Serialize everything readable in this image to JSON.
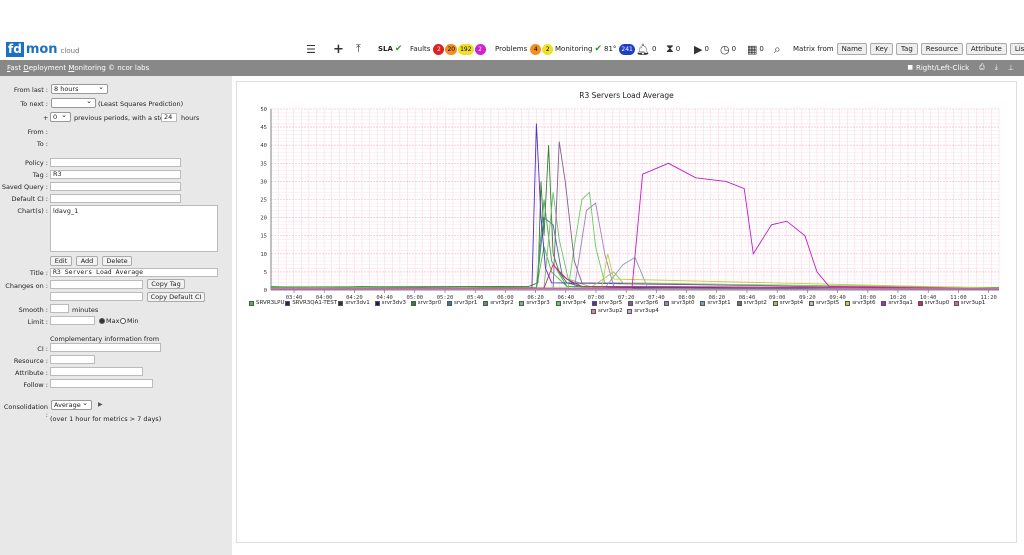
{
  "logo": {
    "fd": "fd",
    "mon": "mon",
    "cloud": "cloud"
  },
  "toolbar": {
    "sla": "SLA",
    "faults_label": "Faults",
    "faults": [
      "2",
      "20",
      "192",
      "2"
    ],
    "problems_label": "Problems",
    "problems": [
      "4",
      "2"
    ],
    "monitoring_label": "Monitoring",
    "monitoring_value": "81°",
    "monitoring_badge": "241",
    "bell_count": "0",
    "hourglass_count": "0",
    "play_count": "0",
    "clock_count": "0",
    "calendar_count": "0",
    "matrix_label": "Matrix from",
    "matrix_buttons": [
      "Name",
      "Key",
      "Tag",
      "Resource",
      "Attribute",
      "List"
    ]
  },
  "subbar": {
    "title_parts": [
      "F",
      "ast ",
      "D",
      "eployment ",
      "M",
      "onitoring © ncor labs"
    ],
    "right_click": "Right/Left-Click"
  },
  "form": {
    "from_last_label": "From last :",
    "from_last_value": "8 hours",
    "to_next_label": "To next :",
    "to_next_value": "",
    "to_next_hint": "(Least Squares Prediction)",
    "plus": "+",
    "periods_value": "0",
    "periods_text": "previous periods, with a step of",
    "step_value": "24",
    "hours": "hours",
    "from_label": "From :",
    "to_label": "To :",
    "policy_label": "Policy :",
    "policy_value": "",
    "tag_label": "Tag :",
    "tag_value": "R3",
    "saved_query_label": "Saved Query :",
    "saved_query_value": "",
    "default_ci_label": "Default CI :",
    "default_ci_value": "",
    "charts_label": "Chart(s) :",
    "charts_value": "ldavg_1",
    "edit": "Edit",
    "add": "Add",
    "delete": "Delete",
    "title_label": "Title :",
    "title_value": "R3 Servers Load Average",
    "changes_on_label": "Changes on :",
    "copy_tag": "Copy Tag",
    "copy_default_ci": "Copy Default CI",
    "smooth_label": "Smooth :",
    "minutes": "minutes",
    "limit_label": "Limit :",
    "max": "Max",
    "min": "Min",
    "complementary": "Complementary information from",
    "ci_label": "CI :",
    "resource_label": "Resource :",
    "attribute_label": "Attribute :",
    "follow_label": "Follow :",
    "consolidation_label": "Consolidation :",
    "consolidation_value": "Average",
    "consolidation_note": "(over 1 hour for metrics > 7 days)"
  },
  "chart_data": {
    "type": "line",
    "title": "R3 Servers Load Average",
    "ylim": [
      0,
      50
    ],
    "yticks": [
      0,
      5,
      10,
      15,
      20,
      25,
      30,
      35,
      40,
      45,
      50
    ],
    "xticks": [
      "03:40",
      "04:00",
      "04:20",
      "04:40",
      "05:00",
      "05:20",
      "05:40",
      "06:00",
      "06:20",
      "06:40",
      "07:00",
      "07:20",
      "07:40",
      "08:00",
      "08:20",
      "08:40",
      "09:00",
      "09:20",
      "09:40",
      "10:00",
      "10:20",
      "10:40",
      "11:00",
      "11:20"
    ],
    "grid": true,
    "legend_position": "bottom",
    "series": [
      {
        "name": "SRVR3LPU",
        "color": "#40c040",
        "points": [
          [
            0,
            1
          ],
          [
            30,
            0.5
          ],
          [
            60,
            1
          ],
          [
            90,
            0.6
          ],
          [
            120,
            0.5
          ],
          [
            150,
            0.8
          ],
          [
            175,
            0.5
          ],
          [
            180,
            12
          ],
          [
            185,
            5
          ],
          [
            195,
            1
          ],
          [
            230,
            0.5
          ],
          [
            260,
            0.8
          ],
          [
            300,
            0.5
          ],
          [
            400,
            0.5
          ],
          [
            480,
            0.7
          ]
        ]
      },
      {
        "name": "SRVR3QA1-TEST",
        "color": "#202080",
        "points": [
          [
            0,
            0.5
          ],
          [
            100,
            0.7
          ],
          [
            180,
            0.4
          ],
          [
            260,
            0.6
          ],
          [
            380,
            0.5
          ],
          [
            480,
            0.5
          ]
        ]
      },
      {
        "name": "srvr3dv1",
        "color": "#303030",
        "points": [
          [
            0,
            0.3
          ],
          [
            200,
            0.4
          ],
          [
            480,
            0.3
          ]
        ]
      },
      {
        "name": "srvr3dv3",
        "color": "#1a1a7a",
        "points": [
          [
            0,
            0.2
          ],
          [
            240,
            0.3
          ],
          [
            480,
            0.2
          ]
        ]
      },
      {
        "name": "srvr3pr0",
        "color": "#308030",
        "points": [
          [
            0,
            0.8
          ],
          [
            170,
            1
          ],
          [
            176,
            2
          ],
          [
            178,
            30
          ],
          [
            180,
            15
          ],
          [
            183,
            40
          ],
          [
            186,
            10
          ],
          [
            190,
            5
          ],
          [
            195,
            2
          ],
          [
            205,
            1
          ],
          [
            230,
            0.8
          ],
          [
            480,
            0.7
          ]
        ]
      },
      {
        "name": "srvr3pr1",
        "color": "#3a7a9a",
        "points": [
          [
            0,
            0.5
          ],
          [
            175,
            0.5
          ],
          [
            180,
            20
          ],
          [
            186,
            18
          ],
          [
            192,
            4
          ],
          [
            202,
            1
          ],
          [
            480,
            0.5
          ]
        ]
      },
      {
        "name": "srvr3pr2",
        "color": "#50a050",
        "points": [
          [
            0,
            0.5
          ],
          [
            175,
            0.7
          ],
          [
            180,
            25
          ],
          [
            185,
            8
          ],
          [
            195,
            1
          ],
          [
            480,
            0.5
          ]
        ]
      },
      {
        "name": "srvr3pr3",
        "color": "#70c070",
        "points": [
          [
            0,
            0.4
          ],
          [
            180,
            0.5
          ],
          [
            186,
            27
          ],
          [
            190,
            14
          ],
          [
            196,
            3
          ],
          [
            210,
            1
          ],
          [
            480,
            0.4
          ]
        ]
      },
      {
        "name": "srvr3pr4",
        "color": "#60d060",
        "points": [
          [
            0,
            0.6
          ],
          [
            196,
            0.6
          ],
          [
            200,
            12
          ],
          [
            205,
            25
          ],
          [
            210,
            27
          ],
          [
            214,
            12
          ],
          [
            220,
            2
          ],
          [
            480,
            0.6
          ]
        ]
      },
      {
        "name": "srvr3pr5",
        "color": "#5030c0",
        "points": [
          [
            0,
            0.4
          ],
          [
            172,
            0.5
          ],
          [
            175,
            46
          ],
          [
            178,
            20
          ],
          [
            181,
            6
          ],
          [
            185,
            2
          ],
          [
            480,
            0.4
          ]
        ]
      },
      {
        "name": "srvr3pr6",
        "color": "#806090",
        "points": [
          [
            0,
            0.5
          ],
          [
            186,
            0.5
          ],
          [
            190,
            41
          ],
          [
            194,
            30
          ],
          [
            200,
            8
          ],
          [
            205,
            2
          ],
          [
            480,
            0.5
          ]
        ]
      },
      {
        "name": "srvr3pt0",
        "color": "#a080c0",
        "points": [
          [
            0,
            0.3
          ],
          [
            200,
            0.4
          ],
          [
            208,
            22
          ],
          [
            214,
            24
          ],
          [
            220,
            10
          ],
          [
            226,
            1
          ],
          [
            480,
            0.3
          ]
        ]
      },
      {
        "name": "srvr3pt1",
        "color": "#80a0c0",
        "points": [
          [
            0,
            0.5
          ],
          [
            220,
            0.5
          ],
          [
            232,
            7
          ],
          [
            240,
            9
          ],
          [
            248,
            1
          ],
          [
            480,
            0.5
          ]
        ]
      },
      {
        "name": "srvr3pt2",
        "color": "#707070",
        "points": [
          [
            0,
            0.3
          ],
          [
            480,
            0.3
          ]
        ]
      },
      {
        "name": "srvr3pt4",
        "color": "#a0c060",
        "points": [
          [
            0,
            0.4
          ],
          [
            210,
            0.5
          ],
          [
            226,
            5
          ],
          [
            232,
            2
          ],
          [
            480,
            0.4
          ]
        ]
      },
      {
        "name": "srvr3pt5",
        "color": "#c0c0a0",
        "points": [
          [
            0,
            0.3
          ],
          [
            480,
            0.3
          ]
        ]
      },
      {
        "name": "srvr3pt6",
        "color": "#c0d040",
        "points": [
          [
            0,
            0.5
          ],
          [
            218,
            0.5
          ],
          [
            222,
            10
          ],
          [
            226,
            3
          ],
          [
            480,
            0.5
          ]
        ]
      },
      {
        "name": "srvr3qa1",
        "color": "#c020c0",
        "points": [
          [
            0,
            0.2
          ],
          [
            238,
            0.5
          ],
          [
            245,
            32
          ],
          [
            262,
            35
          ],
          [
            280,
            31
          ],
          [
            300,
            30
          ],
          [
            312,
            28
          ],
          [
            318,
            10
          ],
          [
            330,
            18
          ],
          [
            340,
            19
          ],
          [
            352,
            15
          ],
          [
            360,
            5
          ],
          [
            368,
            1
          ],
          [
            480,
            0.3
          ]
        ]
      },
      {
        "name": "srvr3up0",
        "color": "#d02080",
        "points": [
          [
            0,
            0.4
          ],
          [
            180,
            0.5
          ],
          [
            186,
            7
          ],
          [
            195,
            3
          ],
          [
            205,
            1
          ],
          [
            480,
            0.4
          ]
        ]
      },
      {
        "name": "srvr3up1",
        "color": "#e060a0",
        "points": [
          [
            0,
            0.3
          ],
          [
            480,
            0.3
          ]
        ]
      },
      {
        "name": "srvr3up2",
        "color": "#e080a0",
        "points": [
          [
            0,
            0.3
          ],
          [
            480,
            0.3
          ]
        ]
      },
      {
        "name": "srvr3up4",
        "color": "#d0a0d0",
        "points": [
          [
            0,
            0.3
          ],
          [
            480,
            0.3
          ]
        ]
      }
    ]
  }
}
